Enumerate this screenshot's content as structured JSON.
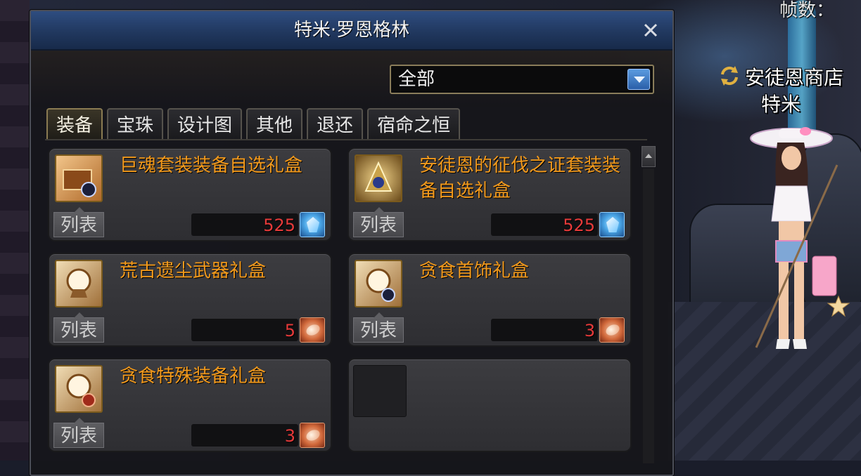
{
  "hud": {
    "fps_label": "帧数："
  },
  "npc": {
    "shop_name": "安徒恩商店",
    "npc_name": "特米"
  },
  "window": {
    "title": "特米·罗恩格林",
    "close_icon": "close-icon"
  },
  "filter": {
    "selected": "全部"
  },
  "tabs": [
    {
      "label": "装备",
      "active": true
    },
    {
      "label": "宝珠",
      "active": false
    },
    {
      "label": "设计图",
      "active": false
    },
    {
      "label": "其他",
      "active": false
    },
    {
      "label": "退还",
      "active": false
    },
    {
      "label": "宿命之恒",
      "active": false
    }
  ],
  "items": [
    {
      "name": "巨魂套装装备自选礼盒",
      "price": "525",
      "currency_icon": "crystal-currency-icon",
      "list_label": "列表"
    },
    {
      "name": "安徒恩的征伐之证套装装备自选礼盒",
      "price": "525",
      "currency_icon": "crystal-currency-icon",
      "list_label": "列表"
    },
    {
      "name": "荒古遗尘武器礼盒",
      "price": "5",
      "currency_icon": "coin-currency-icon",
      "list_label": "列表"
    },
    {
      "name": "贪食首饰礼盒",
      "price": "3",
      "currency_icon": "coin-currency-icon",
      "list_label": "列表"
    },
    {
      "name": "贪食特殊装备礼盒",
      "price": "3",
      "currency_icon": "coin-currency-icon",
      "list_label": "列表"
    }
  ],
  "colors": {
    "item_name": "#f39a1c",
    "price": "#e63a3a",
    "title_bar": "#2e4d80"
  }
}
